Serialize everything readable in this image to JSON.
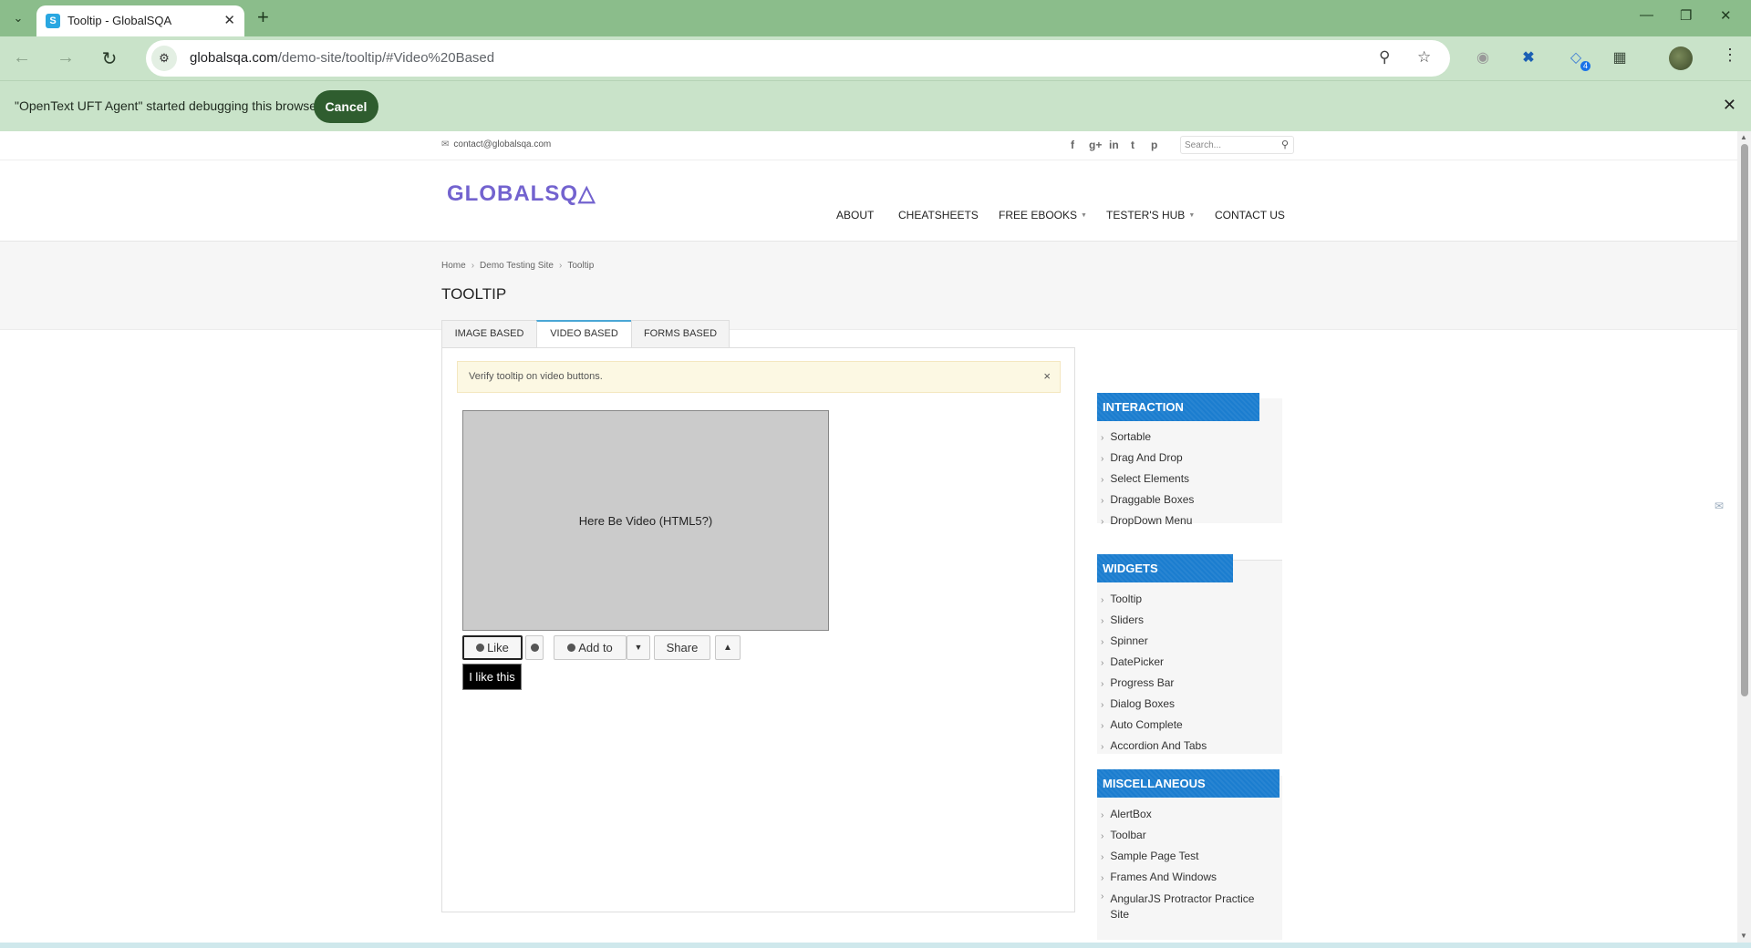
{
  "browser": {
    "tab_title": "Tooltip - GlobalSQA",
    "tab_favicon": "S",
    "url_host": "globalsqa.com",
    "url_path": "/demo-site/tooltip/#Video%20Based",
    "extension_badge": "4",
    "icons": [
      "tab-search-icon",
      "back-icon",
      "forward-icon",
      "reload-icon",
      "site-info-icon",
      "zoom-icon",
      "bookmark-star-icon",
      "camera-icon",
      "extension-x-icon",
      "extension-puzzle-icon",
      "menu-kebab-icon"
    ]
  },
  "infobar": {
    "message": "\"OpenText UFT Agent\" started debugging this browser",
    "cancel_label": "Cancel"
  },
  "topbar": {
    "email": "contact@globalsqa.com",
    "social": [
      "f",
      "g+",
      "in",
      "t",
      "p"
    ],
    "search_placeholder": "Search..."
  },
  "header": {
    "logo": "GLOBALSQ△",
    "nav": [
      "ABOUT",
      "CHEATSHEETS",
      "FREE EBOOKS",
      "TESTER'S HUB",
      "CONTACT US"
    ]
  },
  "breadcrumb": [
    "Home",
    "Demo Testing Site",
    "Tooltip"
  ],
  "page_title": "TOOLTIP",
  "tabs": [
    "IMAGE BASED",
    "VIDEO BASED",
    "FORMS BASED"
  ],
  "active_tab": "VIDEO BASED",
  "alert": {
    "text": "Verify tooltip on video buttons.",
    "close": "×"
  },
  "video": {
    "placeholder": "Here Be Video (HTML5?)",
    "buttons": {
      "like": "Like",
      "add_to": "Add to",
      "share": "Share"
    },
    "tooltip": "I like this"
  },
  "sidebar": {
    "sections": [
      {
        "title": "INTERACTION",
        "items": [
          "Sortable",
          "Drag And Drop",
          "Select Elements",
          "Draggable Boxes",
          "DropDown Menu"
        ]
      },
      {
        "title": "WIDGETS",
        "items": [
          "Tooltip",
          "Sliders",
          "Spinner",
          "DatePicker",
          "Progress Bar",
          "Dialog Boxes",
          "Auto Complete",
          "Accordion And Tabs"
        ]
      },
      {
        "title": "MISCELLANEOUS",
        "items": [
          "AlertBox",
          "Toolbar",
          "Sample Page Test",
          "Frames And Windows",
          "AngularJS Protractor Practice Site"
        ]
      }
    ]
  },
  "colors": {
    "chrome_dark": "#8bbd8b",
    "chrome_light": "#c9e3c9",
    "logo": "#7363cf",
    "sidebar_header": "#1b7dcf",
    "alert_bg": "#fcf8e3"
  }
}
